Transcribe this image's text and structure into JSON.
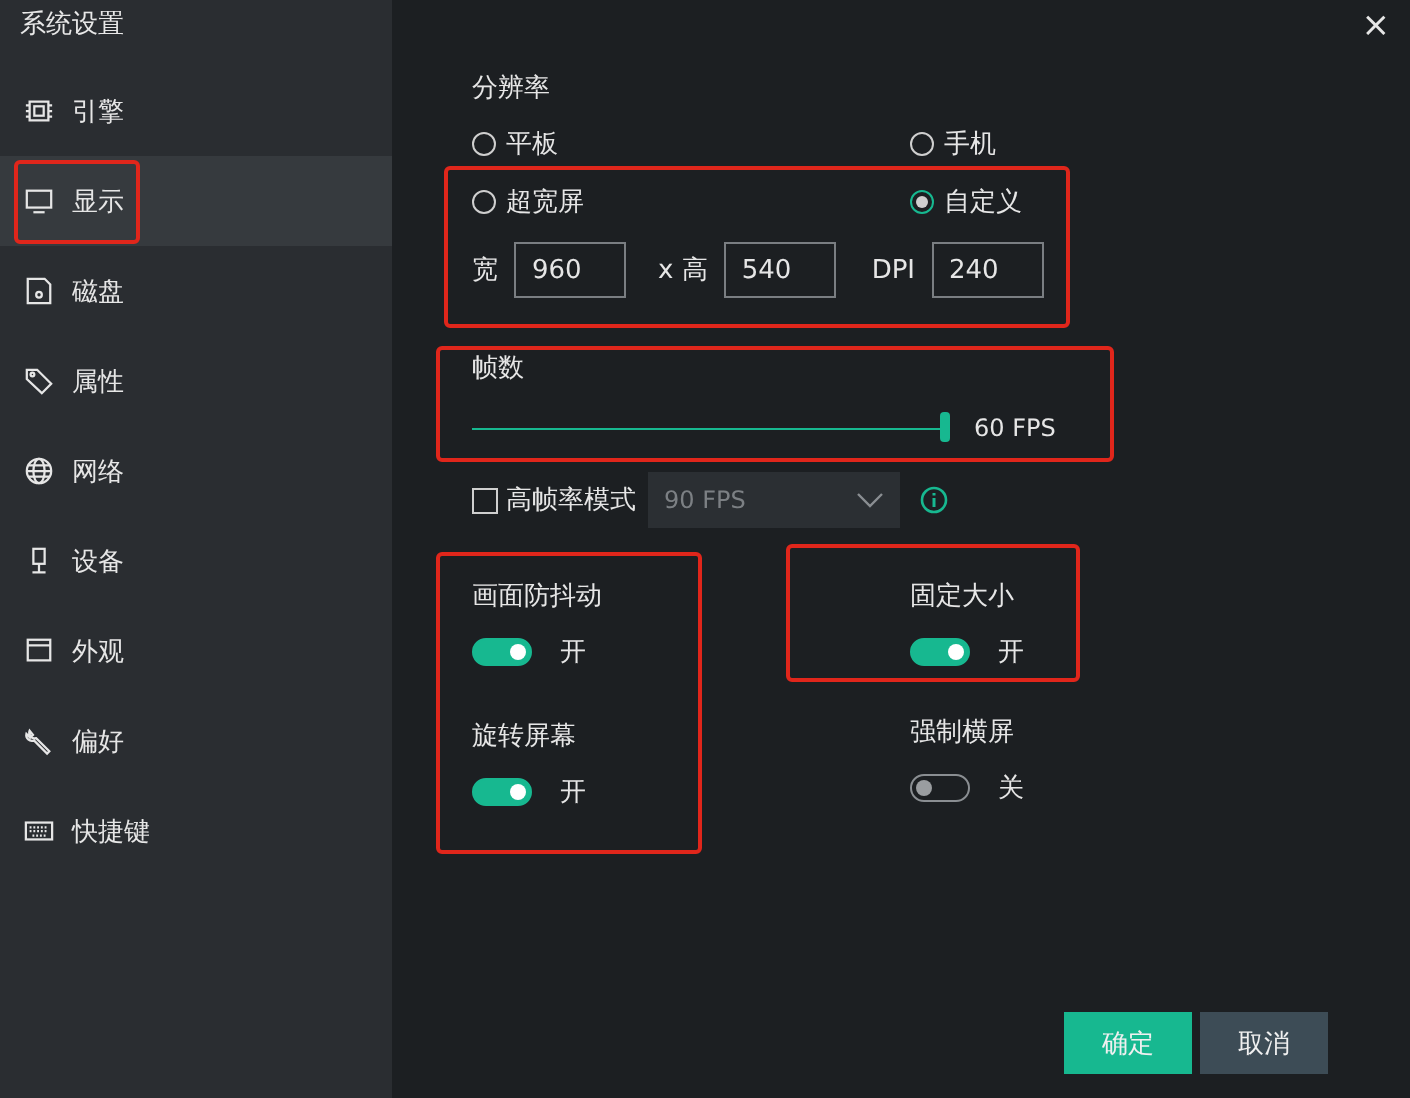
{
  "window": {
    "title": "系统设置",
    "close": "×"
  },
  "sidebar": {
    "items": [
      {
        "label": "引擎",
        "selected": false,
        "highlighted": false
      },
      {
        "label": "显示",
        "selected": true,
        "highlighted": true
      },
      {
        "label": "磁盘",
        "selected": false,
        "highlighted": false
      },
      {
        "label": "属性",
        "selected": false,
        "highlighted": false
      },
      {
        "label": "网络",
        "selected": false,
        "highlighted": false
      },
      {
        "label": "设备",
        "selected": false,
        "highlighted": false
      },
      {
        "label": "外观",
        "selected": false,
        "highlighted": false
      },
      {
        "label": "偏好",
        "selected": false,
        "highlighted": false
      },
      {
        "label": "快捷键",
        "selected": false,
        "highlighted": false
      }
    ]
  },
  "resolution": {
    "title": "分辨率",
    "groups": [
      {
        "highlighted": false,
        "options": [
          {
            "label": "平板",
            "selected": false
          },
          {
            "label": "手机",
            "selected": false
          }
        ]
      },
      {
        "highlighted": true,
        "options": [
          {
            "label": "超宽屏",
            "selected": false
          },
          {
            "label": "自定义",
            "selected": true
          }
        ],
        "fields": [
          {
            "label": "宽",
            "value": "960"
          },
          {
            "label": "x 高",
            "value": "540"
          },
          {
            "label": "DPI",
            "value": "240"
          }
        ]
      }
    ]
  },
  "frame_rate": {
    "title": "帧数",
    "highlighted": true,
    "level": 1.0,
    "reading": "60 FPS"
  },
  "high_frame_rate": {
    "label": "高帧率模式",
    "checked": false,
    "dropdown": "90 FPS"
  },
  "toggle_columns": [
    {
      "groups": [
        {
          "highlighted": true,
          "items": [
            {
              "label": "画面防抖动",
              "on": true,
              "state_text": "开"
            },
            {
              "label": "旋转屏幕",
              "on": true,
              "state_text": "开"
            }
          ]
        }
      ]
    },
    {
      "groups": [
        {
          "highlighted": true,
          "items": [
            {
              "label": "固定大小",
              "on": true,
              "state_text": "开"
            }
          ]
        },
        {
          "highlighted": false,
          "items": [
            {
              "label": "强制横屏",
              "on": false,
              "state_text": "关"
            }
          ]
        }
      ]
    }
  ],
  "buttons": [
    {
      "label": "确定",
      "kind": "primary"
    },
    {
      "label": "取消",
      "kind": "secondary"
    }
  ]
}
